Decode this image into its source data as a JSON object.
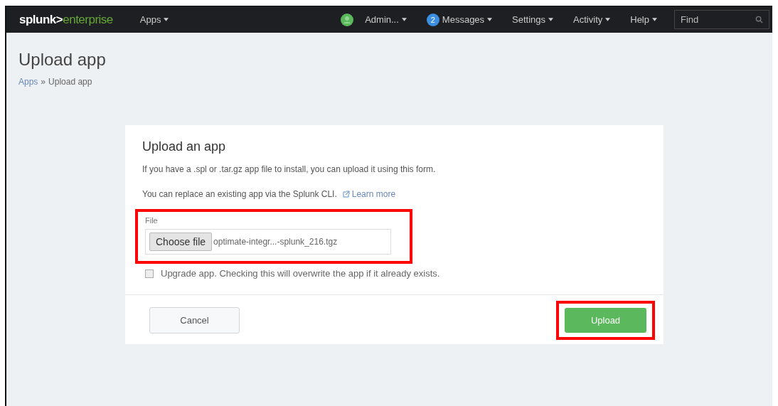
{
  "top_bar": {
    "logo": {
      "brand": "splunk>",
      "product": "enterprise"
    },
    "nav_left": [
      {
        "label": "Apps"
      }
    ],
    "nav_right": [
      {
        "label": "Admin...",
        "kind": "user"
      },
      {
        "label": "Messages",
        "kind": "messages",
        "badge": "2"
      },
      {
        "label": "Settings",
        "kind": "plain"
      },
      {
        "label": "Activity",
        "kind": "plain"
      },
      {
        "label": "Help",
        "kind": "plain"
      }
    ],
    "search": {
      "placeholder": "Find"
    }
  },
  "page": {
    "title": "Upload app",
    "breadcrumb": [
      {
        "label": "Apps",
        "kind": "link"
      },
      {
        "label": "»",
        "kind": "separator"
      },
      {
        "label": "Upload app",
        "kind": "current"
      }
    ]
  },
  "card": {
    "title": "Upload an app",
    "intro": "If you have a .spl or .tar.gz app file to install, you can upload it using this form.",
    "replace_text": "You can replace an existing app via the Splunk CLI.",
    "learn_more": "Learn more",
    "file_field": {
      "label": "File",
      "button": "Choose file",
      "value": "optimate-integr...-splunk_216.tgz",
      "highlighted": true
    },
    "upgrade": {
      "label": "Upgrade app. Checking this will overwrite the app if it already exists.",
      "checked": false
    },
    "cancel": "Cancel",
    "upload": {
      "label": "Upload",
      "highlighted": true
    }
  }
}
